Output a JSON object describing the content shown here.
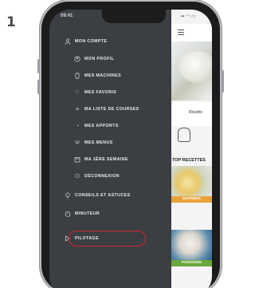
{
  "step": "1",
  "status": {
    "time": "09:41"
  },
  "menu": {
    "items": [
      {
        "label": "MON COMPTE",
        "icon": "user-icon",
        "level": 0
      },
      {
        "label": "MON PROFIL",
        "icon": "profile-icon",
        "level": 1
      },
      {
        "label": "MES MACHINES",
        "icon": "device-icon",
        "level": 1
      },
      {
        "label": "MES FAVORIS",
        "icon": "heart-icon",
        "level": 1
      },
      {
        "label": "MA LISTE DE COURSES",
        "icon": "list-icon",
        "level": 1
      },
      {
        "label": "MES APPORTS",
        "icon": "nutrition-icon",
        "level": 1
      },
      {
        "label": "MES MENUS",
        "icon": "cutlery-icon",
        "level": 1
      },
      {
        "label": "MA 1ÈRE SEMAINE",
        "icon": "calendar-icon",
        "level": 1
      },
      {
        "label": "DÉCONNEXION",
        "icon": "logout-icon",
        "level": 1
      },
      {
        "label": "CONSEILS ET ASTUCES",
        "icon": "lightbulb-icon",
        "level": 0
      },
      {
        "label": "MINUTEUR",
        "icon": "timer-icon",
        "level": 0
      },
      {
        "label": "PILOTAGE",
        "icon": "remote-icon",
        "level": 0
      }
    ]
  },
  "app": {
    "recipe_caption": "Risotto",
    "section_title": "TOP RECETTES",
    "cards": [
      {
        "tag": "ENTRÉES"
      },
      {
        "tag": "POISSONS"
      }
    ]
  },
  "colors": {
    "drawer": "#3b3e42",
    "highlight": "#d3262e",
    "card_tag_1": "#e8a33b",
    "card_tag_2": "#6aa83a"
  }
}
